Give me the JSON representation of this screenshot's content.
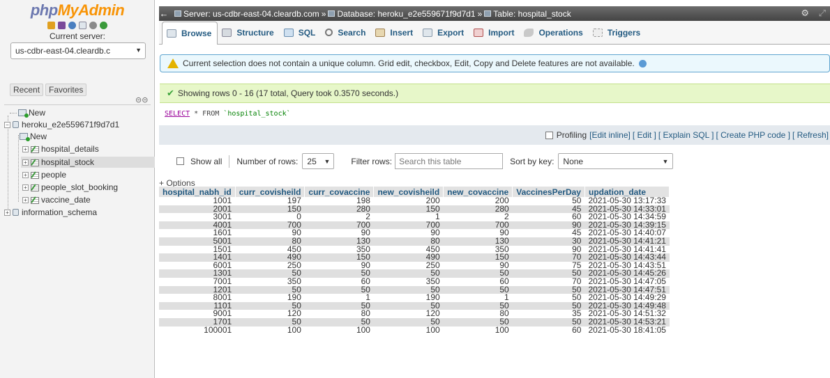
{
  "app": {
    "logo_php": "php",
    "logo_myadmin": "MyAdmin"
  },
  "nav": {
    "current_server_label": "Current server:",
    "server_select": "us-cdbr-east-04.cleardb.c",
    "tabs": [
      "Recent",
      "Favorites"
    ],
    "tree": {
      "new_root": "New",
      "db_main": "heroku_e2e559671f9d7d1",
      "new_db": "New",
      "tables": [
        "hospital_details",
        "hospital_stock",
        "people",
        "people_slot_booking",
        "vaccine_date"
      ],
      "schema": "information_schema"
    }
  },
  "breadcrumb": {
    "server": "Server: us-cdbr-east-04.cleardb.com",
    "database": "Database: heroku_e2e559671f9d7d1",
    "table": "Table: hospital_stock"
  },
  "tabs": [
    "Browse",
    "Structure",
    "SQL",
    "Search",
    "Insert",
    "Export",
    "Import",
    "Operations",
    "Triggers"
  ],
  "warning": "Current selection does not contain a unique column. Grid edit, checkbox, Edit, Copy and Delete features are not available.",
  "success": "Showing rows 0 - 16 (17 total, Query took 0.3570 seconds.)",
  "sql": {
    "select": "SELECT",
    "rest": " * FROM ",
    "table": "`hospital_stock`"
  },
  "profiling": {
    "label": "Profiling",
    "links": [
      "[Edit inline]",
      "[ Edit ]",
      "[ Explain SQL ]",
      "[ Create PHP code ]",
      "[ Refresh]"
    ]
  },
  "controls": {
    "show_all": "Show all",
    "rows_label": "Number of rows:",
    "rows_value": "25",
    "filter_label": "Filter rows:",
    "filter_placeholder": "Search this table",
    "sort_label": "Sort by key:",
    "sort_value": "None"
  },
  "options_link": "+ Options",
  "table": {
    "columns": [
      "hospital_nabh_id",
      "curr_covisheild",
      "curr_covaccine",
      "new_covisheild",
      "new_covaccine",
      "VaccinesPerDay",
      "updation_date"
    ],
    "rows": [
      [
        "1001",
        "197",
        "198",
        "200",
        "200",
        "50",
        "2021-05-30 13:17:33"
      ],
      [
        "2001",
        "150",
        "280",
        "150",
        "280",
        "45",
        "2021-05-30 14:33:01"
      ],
      [
        "3001",
        "0",
        "2",
        "1",
        "2",
        "60",
        "2021-05-30 14:34:59"
      ],
      [
        "4001",
        "700",
        "700",
        "700",
        "700",
        "90",
        "2021-05-30 14:39:15"
      ],
      [
        "1601",
        "90",
        "90",
        "90",
        "90",
        "45",
        "2021-05-30 14:40:07"
      ],
      [
        "5001",
        "80",
        "130",
        "80",
        "130",
        "30",
        "2021-05-30 14:41:21"
      ],
      [
        "1501",
        "450",
        "350",
        "450",
        "350",
        "90",
        "2021-05-30 14:41:41"
      ],
      [
        "1401",
        "490",
        "150",
        "490",
        "150",
        "70",
        "2021-05-30 14:43:44"
      ],
      [
        "6001",
        "250",
        "90",
        "250",
        "90",
        "75",
        "2021-05-30 14:43:51"
      ],
      [
        "1301",
        "50",
        "50",
        "50",
        "50",
        "50",
        "2021-05-30 14:45:26"
      ],
      [
        "7001",
        "350",
        "60",
        "350",
        "60",
        "70",
        "2021-05-30 14:47:05"
      ],
      [
        "1201",
        "50",
        "50",
        "50",
        "50",
        "50",
        "2021-05-30 14:47:51"
      ],
      [
        "8001",
        "190",
        "1",
        "190",
        "1",
        "50",
        "2021-05-30 14:49:29"
      ],
      [
        "1101",
        "50",
        "50",
        "50",
        "50",
        "50",
        "2021-05-30 14:49:48"
      ],
      [
        "9001",
        "120",
        "80",
        "120",
        "80",
        "35",
        "2021-05-30 14:51:32"
      ],
      [
        "1701",
        "50",
        "50",
        "50",
        "50",
        "50",
        "2021-05-30 14:53:21"
      ],
      [
        "100001",
        "100",
        "100",
        "100",
        "100",
        "60",
        "2021-05-30 18:41:05"
      ]
    ]
  },
  "colors": {
    "link": "#235a81",
    "logo_php": "#6c78af",
    "logo_myadmin": "#f89406",
    "success_bg": "#e7f7c9",
    "warning_bg": "#ebf8fd"
  }
}
